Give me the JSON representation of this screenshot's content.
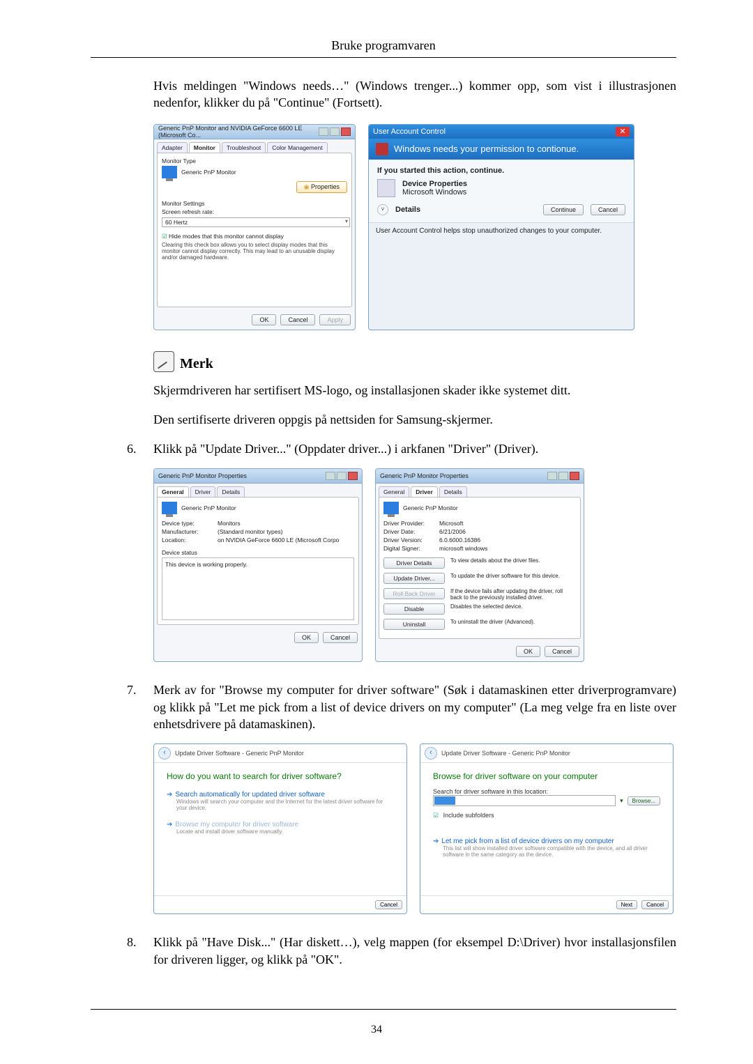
{
  "header": "Bruke programvaren",
  "page_number": "34",
  "intro_paragraph": "Hvis meldingen \"Windows needs…\" (Windows trenger...) kommer opp, som vist i illustrasjonen nedenfor, klikker du på \"Continue\" (Fortsett).",
  "note": {
    "title": "Merk",
    "text1": "Skjermdriveren har sertifisert MS-logo, og installasjonen skader ikke systemet ditt.",
    "text2": "Den sertifiserte driveren oppgis på nettsiden for Samsung-skjermer."
  },
  "steps": {
    "s6": {
      "num": "6.",
      "text": "Klikk på \"Update Driver...\" (Oppdater driver...) i arkfanen \"Driver\" (Driver)."
    },
    "s7": {
      "num": "7.",
      "text": "Merk av for \"Browse my computer for driver software\" (Søk i datamaskinen etter driverprogramvare) og klikk på \"Let me pick from a list of device drivers on my computer\" (La meg velge fra en liste over enhetsdrivere på datamaskinen)."
    },
    "s8": {
      "num": "8.",
      "text": "Klikk på \"Have Disk...\" (Har diskett…), velg mappen (for eksempel D:\\Driver) hvor installasjonsfilen for driveren ligger, og klikk på \"OK\"."
    }
  },
  "fig1": {
    "monitor_dialog": {
      "title": "Generic PnP Monitor and NVIDIA GeForce 6600 LE (Microsoft Co...",
      "tabs": {
        "adapter": "Adapter",
        "monitor": "Monitor",
        "troubleshoot": "Troubleshoot",
        "color": "Color Management"
      },
      "monitor_type_label": "Monitor Type",
      "monitor_type_value": "Generic PnP Monitor",
      "properties_btn": "Properties",
      "monitor_settings_label": "Monitor Settings",
      "refresh_label": "Screen refresh rate:",
      "refresh_value": "60 Hertz",
      "hide_modes_label": "Hide modes that this monitor cannot display",
      "hide_modes_help": "Clearing this check box allows you to select display modes that this monitor cannot display correctly. This may lead to an unusable display and/or damaged hardware.",
      "ok": "OK",
      "cancel": "Cancel",
      "apply": "Apply"
    },
    "uac": {
      "title": "User Account Control",
      "need": "Windows needs your permission to contionue.",
      "started": "If you started this action, continue.",
      "app_name": "Device Properties",
      "publisher": "Microsoft Windows",
      "details": "Details",
      "continue": "Continue",
      "cancel": "Cancel",
      "footer": "User Account Control helps stop unauthorized changes to your computer."
    }
  },
  "fig2": {
    "left": {
      "title": "Generic PnP Monitor Properties",
      "tabs": {
        "general": "General",
        "driver": "Driver",
        "details": "Details"
      },
      "name": "Generic PnP Monitor",
      "device_type_k": "Device type:",
      "device_type_v": "Monitors",
      "manufacturer_k": "Manufacturer:",
      "manufacturer_v": "(Standard monitor types)",
      "location_k": "Location:",
      "location_v": "on NVIDIA GeForce 6600 LE (Microsoft Corpo",
      "status_label": "Device status",
      "status_text": "This device is working properly.",
      "ok": "OK",
      "cancel": "Cancel"
    },
    "right": {
      "title": "Generic PnP Monitor Properties",
      "tabs": {
        "general": "General",
        "driver": "Driver",
        "details": "Details"
      },
      "name": "Generic PnP Monitor",
      "provider_k": "Driver Provider:",
      "provider_v": "Microsoft",
      "date_k": "Driver Date:",
      "date_v": "6/21/2006",
      "version_k": "Driver Version:",
      "version_v": "6.0.6000.16386",
      "signer_k": "Digital Signer:",
      "signer_v": "microsoft windows",
      "btn_details": "Driver Details",
      "desc_details": "To view details about the driver files.",
      "btn_update": "Update Driver...",
      "desc_update": "To update the driver software for this device.",
      "btn_rollback": "Roll Back Driver",
      "desc_rollback": "If the device fails after updating the driver, roll back to the previously installed driver.",
      "btn_disable": "Disable",
      "desc_disable": "Disables the selected device.",
      "btn_uninstall": "Uninstall",
      "desc_uninstall": "To uninstall the driver (Advanced).",
      "ok": "OK",
      "cancel": "Cancel"
    }
  },
  "fig3": {
    "left": {
      "title": "Update Driver Software - Generic PnP Monitor",
      "heading": "How do you want to search for driver software?",
      "opt1": "Search automatically for updated driver software",
      "opt1_sub": "Windows will search your computer and the Internet for the latest driver software for your device.",
      "opt2": "Browse my computer for driver software",
      "opt2_sub": "Locate and install driver software manually.",
      "cancel": "Cancel"
    },
    "right": {
      "title": "Update Driver Software - Generic PnP Monitor",
      "heading": "Browse for driver software on your computer",
      "search_label": "Search for driver software in this location:",
      "browse": "Browse...",
      "include": "Include subfolders",
      "opt": "Let me pick from a list of device drivers on my computer",
      "opt_sub": "This list will show installed driver software compatible with the device, and all driver software in the same category as the device.",
      "next": "Next",
      "cancel": "Cancel"
    }
  }
}
